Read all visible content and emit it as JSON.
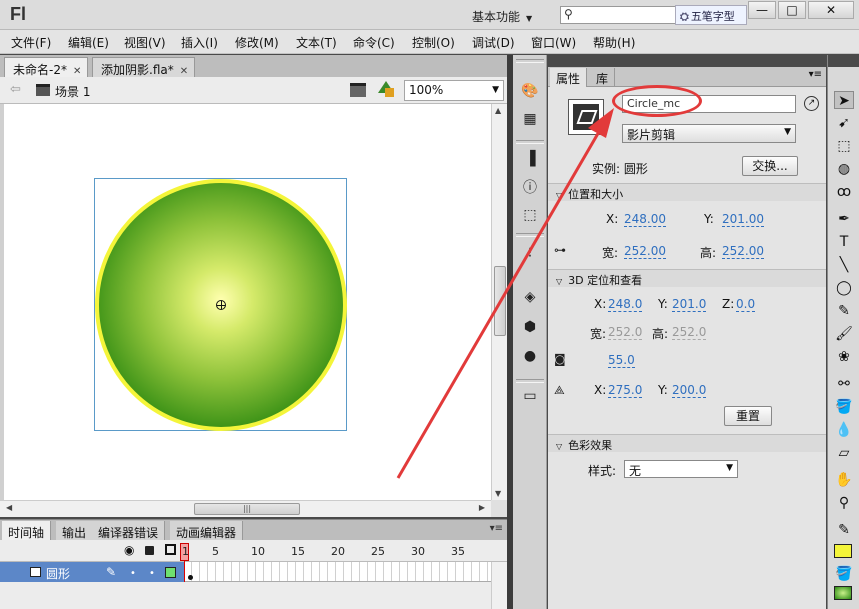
{
  "app": {
    "logo": "Fl",
    "workspace": "基本功能",
    "ime_label": "五笔字型"
  },
  "window_buttons": [
    "—",
    "□",
    "✕"
  ],
  "menu": [
    "文件(F)",
    "编辑(E)",
    "视图(V)",
    "插入(I)",
    "修改(M)",
    "文本(T)",
    "命令(C)",
    "控制(O)",
    "调试(D)",
    "窗口(W)",
    "帮助(H)"
  ],
  "doc_tabs": [
    {
      "label": "未命名-2*"
    },
    {
      "label": "添加阴影.fla*"
    }
  ],
  "editbar": {
    "scene": "场景 1",
    "zoom": "100%"
  },
  "stage": {
    "shape_colors": {
      "center": "#ffffb0",
      "edge": "#1d6e0a",
      "stroke": "#f4f53a"
    }
  },
  "timeline": {
    "tabs": [
      "时间轴",
      "输出",
      "编译器错误",
      "动画编辑器"
    ],
    "frame_numbers": [
      "1",
      "5",
      "10",
      "15",
      "20",
      "25",
      "30",
      "35"
    ],
    "layer": {
      "name": "圆形",
      "color": "#6fe06f"
    }
  },
  "properties": {
    "tabs": [
      "属性",
      "库"
    ],
    "instance_name": "Circle_mc",
    "symbol_type": "影片剪辑",
    "instance_of_label": "实例:",
    "instance_of_value": "圆形",
    "swap_label": "交换...",
    "pos_size": {
      "title": "位置和大小",
      "x_label": "X:",
      "x": "248.00",
      "y_label": "Y:",
      "y": "201.00",
      "w_label": "宽:",
      "w": "252.00",
      "h_label": "高:",
      "h": "252.00"
    },
    "three_d": {
      "title": "3D 定位和查看",
      "x_label": "X:",
      "x": "248.0",
      "y_label": "Y:",
      "y": "201.0",
      "z_label": "Z:",
      "z": "0.0",
      "w_label": "宽:",
      "w": "252.0",
      "h_label": "高:",
      "h": "252.0",
      "perspective": "55.0",
      "vanish_x_label": "X:",
      "vanish_x": "275.0",
      "vanish_y_label": "Y:",
      "vanish_y": "200.0",
      "reset_label": "重置"
    },
    "color_effect": {
      "title": "色彩效果",
      "style_label": "样式:",
      "style_value": "无"
    }
  },
  "annotation": {
    "ellipse_color": "#e23a3a"
  }
}
